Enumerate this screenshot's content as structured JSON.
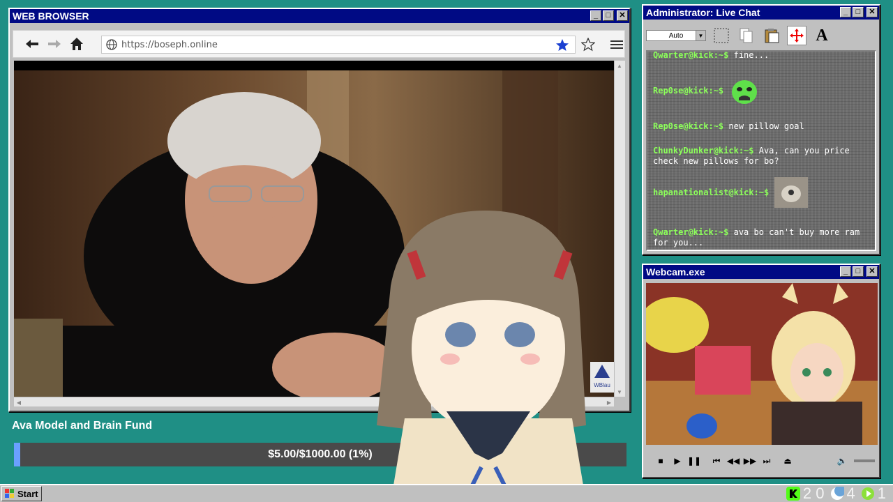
{
  "browser": {
    "title": "WEB BROWSER",
    "url": "https://boseph.online",
    "video_watermark": "WBlau"
  },
  "chat": {
    "title": "Administrator: Live Chat",
    "font_select": "Auto",
    "messages": [
      {
        "user": "Qwarter@kick:~$",
        "text": "fine..."
      },
      {
        "user": "Rep0se@kick:~$",
        "text": "",
        "emote": "green-crying-emote"
      },
      {
        "user": "Rep0se@kick:~$",
        "text": "new pillow goal"
      },
      {
        "user": "ChunkyDunker@kick:~$",
        "text": "Ava, can you price check new pillows for bo?"
      },
      {
        "user": "hapanationalist@kick:~$",
        "text": "",
        "emote": "image-emote"
      },
      {
        "user": "Qwarter@kick:~$",
        "text": "ava bo can't buy more ram for you..."
      }
    ]
  },
  "webcam": {
    "title": "Webcam.exe"
  },
  "fund": {
    "title": "Ava Model and Brain Fund",
    "progress_text": "$5.00/$1000.00 (1%)",
    "raised": 5.0,
    "goal": 1000.0,
    "percent": 1
  },
  "taskbar": {
    "start_label": "Start",
    "tray_count_1": "2 0",
    "tray_count_2": "4",
    "tray_count_3": "1"
  },
  "colors": {
    "desktop": "#1f8f85",
    "titlebar": "#000a84",
    "chat_user": "#8cff5a",
    "fund_bar": "#4a4a4a"
  }
}
